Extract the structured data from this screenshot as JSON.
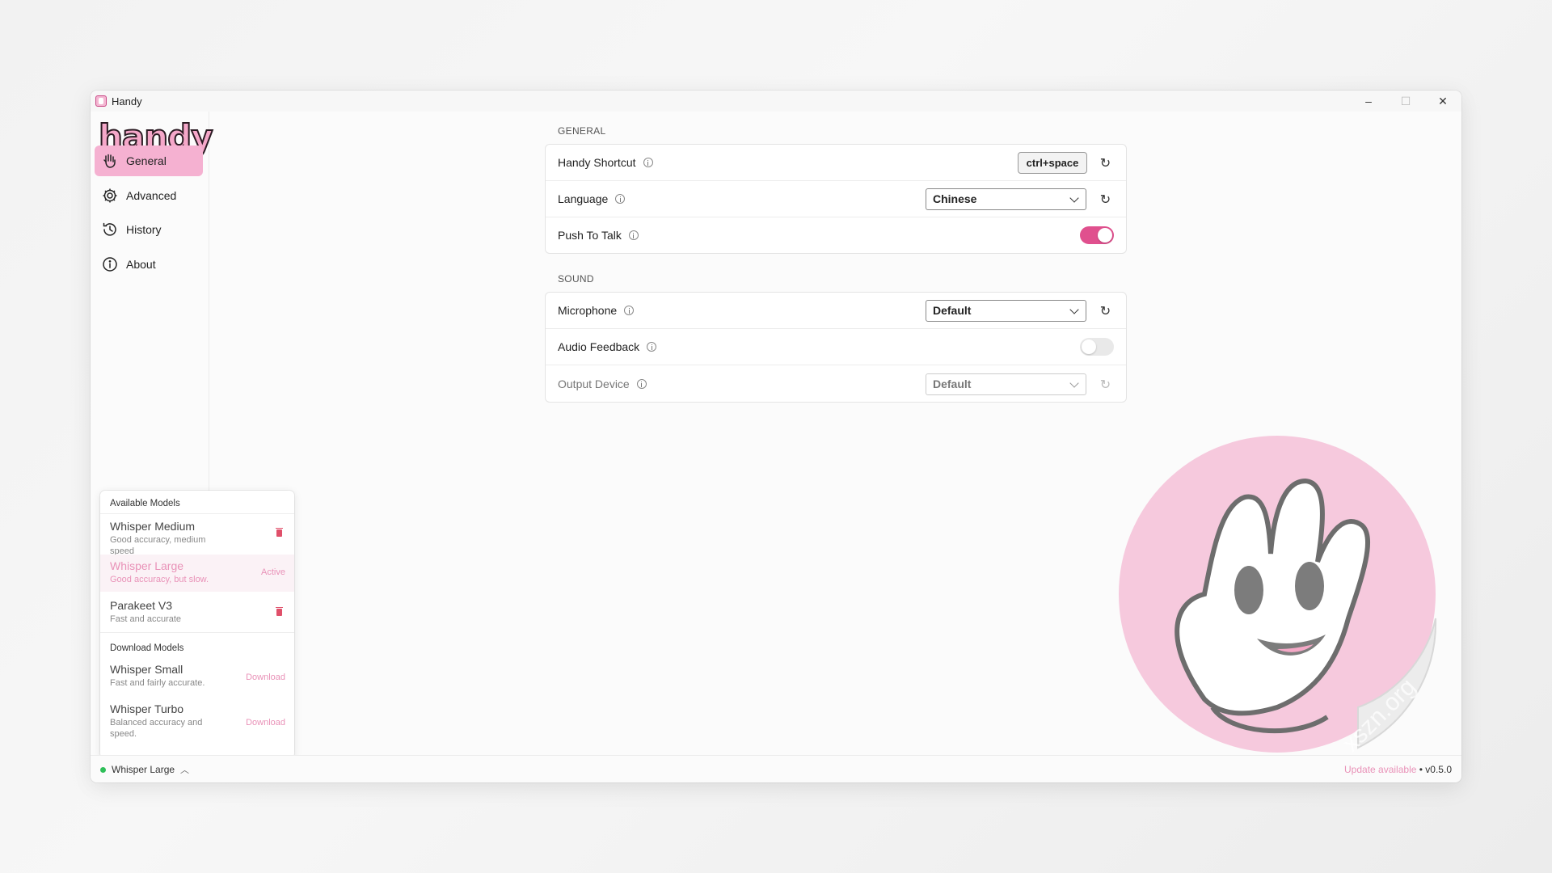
{
  "window": {
    "title": "Handy"
  },
  "brand": {
    "logo_text": "handy",
    "accent": "#f5b1d1",
    "toggle_on": "#e0508e",
    "status_ok": "#2fbf59"
  },
  "sidebar": {
    "items": [
      {
        "label": "General",
        "icon": "hand-icon",
        "active": true
      },
      {
        "label": "Advanced",
        "icon": "gear-icon"
      },
      {
        "label": "History",
        "icon": "history-icon"
      },
      {
        "label": "About",
        "icon": "info-icon"
      }
    ]
  },
  "general": {
    "section_label": "GENERAL",
    "shortcut": {
      "label": "Handy Shortcut",
      "value": "ctrl+space"
    },
    "language": {
      "label": "Language",
      "value": "Chinese"
    },
    "push_to_talk": {
      "label": "Push To Talk",
      "enabled": true
    }
  },
  "sound": {
    "section_label": "SOUND",
    "microphone": {
      "label": "Microphone",
      "value": "Default"
    },
    "audio_feedback": {
      "label": "Audio Feedback",
      "enabled": false
    },
    "output_device": {
      "label": "Output Device",
      "value": "Default"
    }
  },
  "models_popup": {
    "available_heading": "Available Models",
    "available": [
      {
        "name": "Whisper Medium",
        "desc": "Good accuracy, medium speed"
      },
      {
        "name": "Whisper Large",
        "desc": "Good accuracy, but slow.",
        "status": "Active"
      },
      {
        "name": "Parakeet V3",
        "desc": "Fast and accurate"
      }
    ],
    "download_heading": "Download Models",
    "downloads": [
      {
        "name": "Whisper Small",
        "desc": "Fast and fairly accurate.",
        "action": "Download"
      },
      {
        "name": "Whisper Turbo",
        "desc": "Balanced accuracy and speed.",
        "action": "Download"
      }
    ]
  },
  "statusbar": {
    "current_model": "Whisper Large",
    "update_text": "Update available",
    "separator": " • ",
    "version": "v0.5.0"
  },
  "watermark": {
    "text": "xszn.org"
  }
}
